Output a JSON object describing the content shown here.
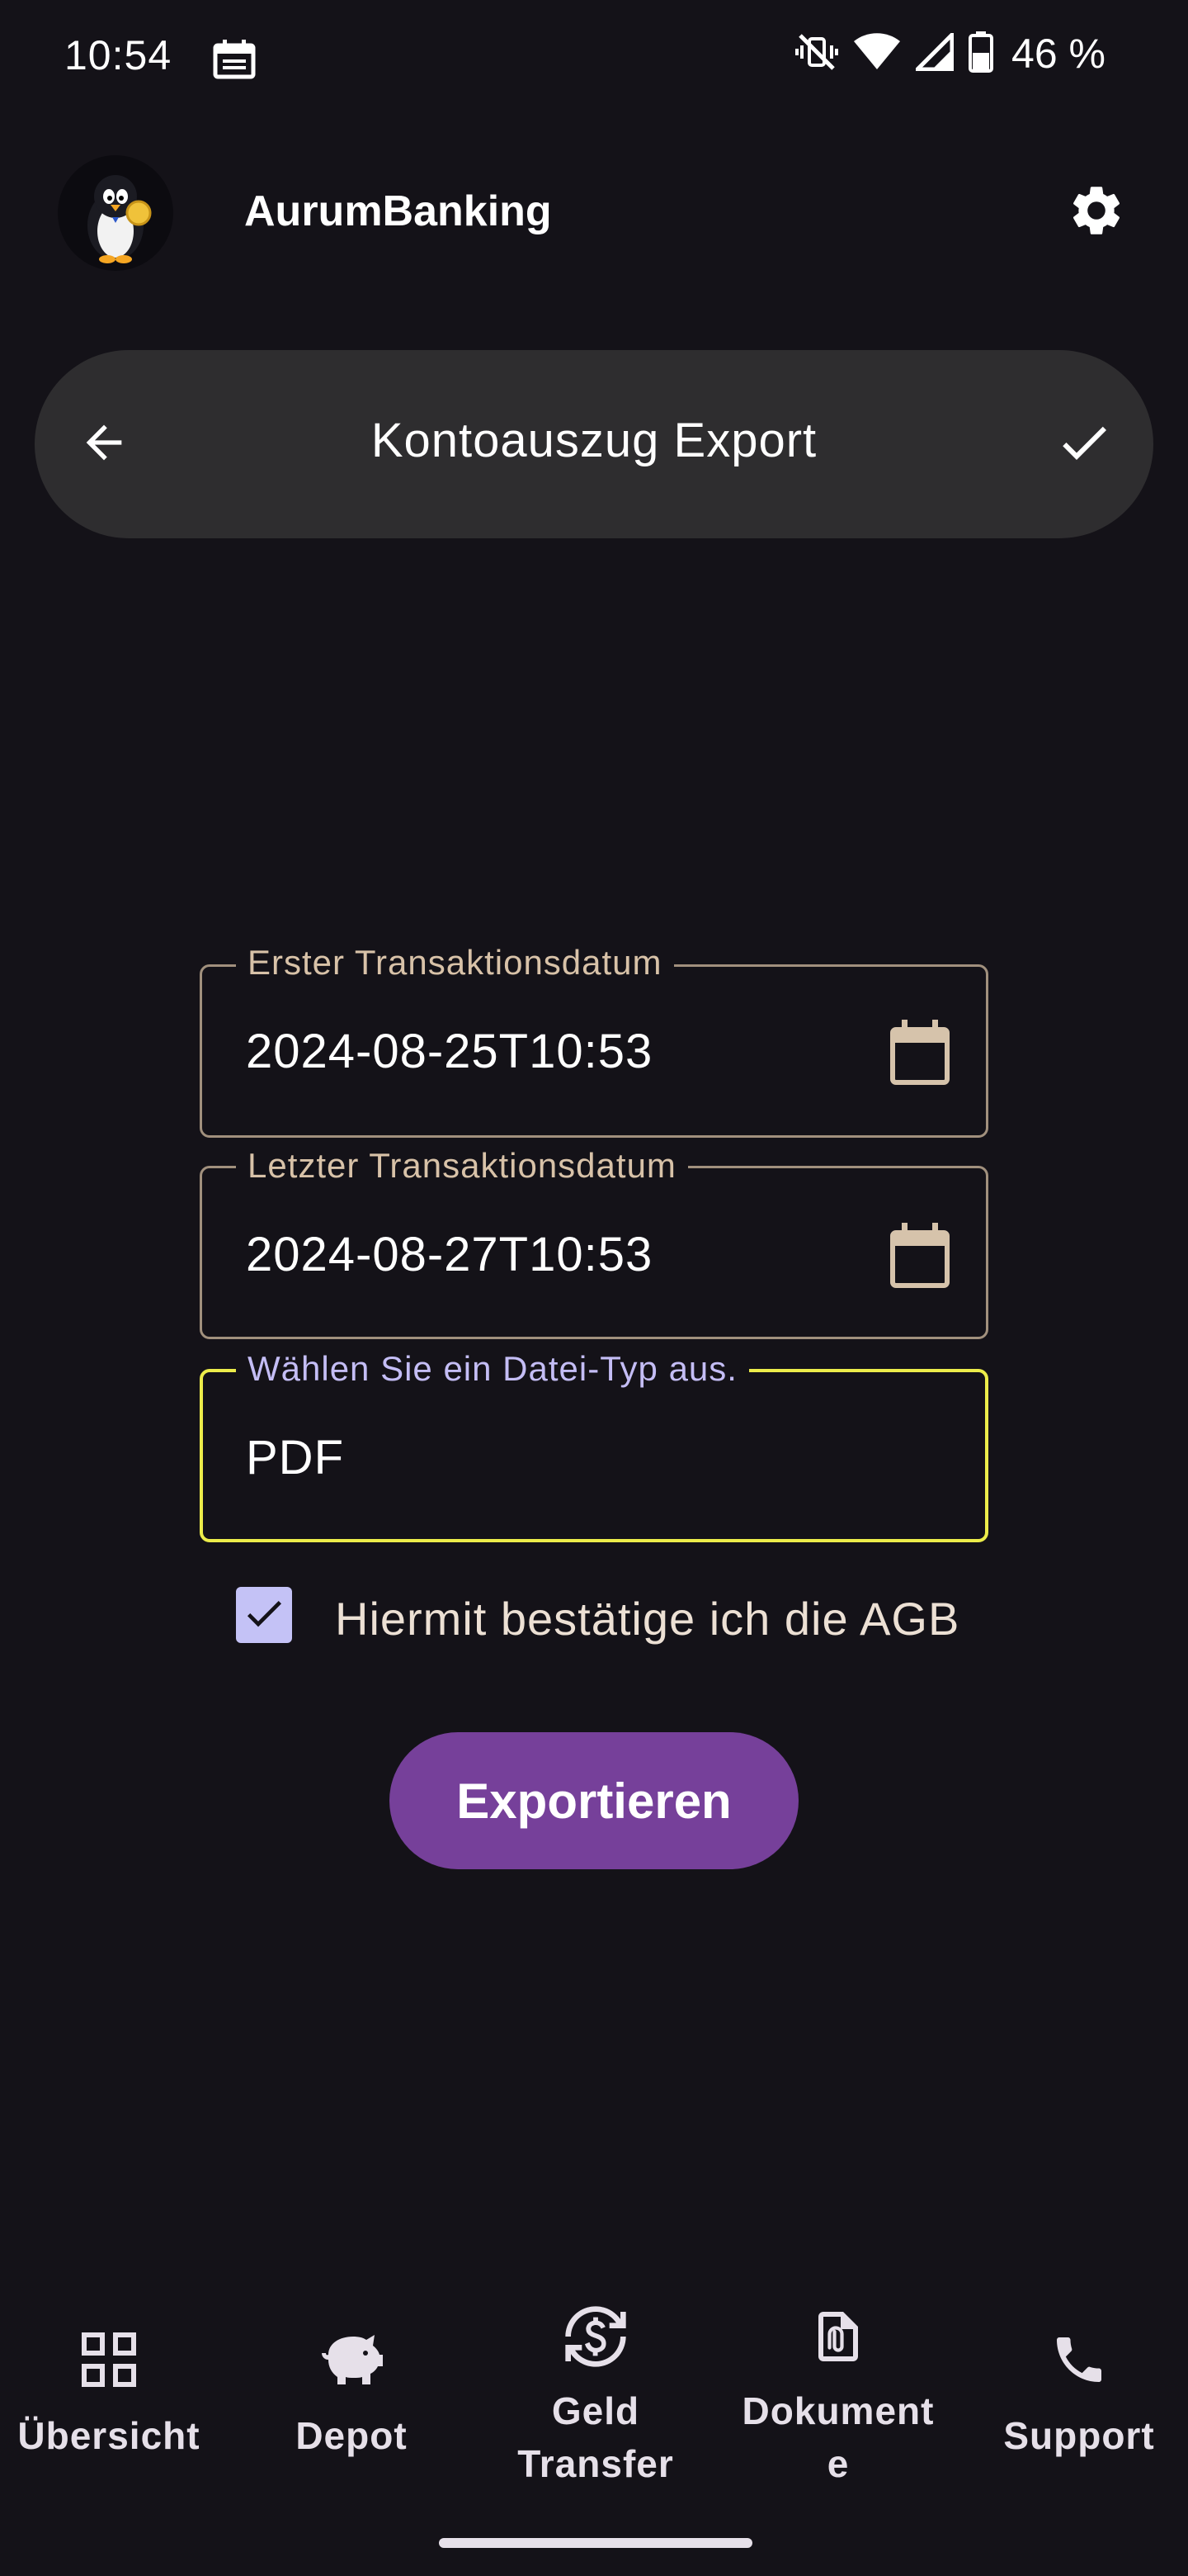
{
  "status_bar": {
    "time": "10:54",
    "battery": "46 %",
    "icons": [
      "calendar-icon",
      "mute-vibrate-icon",
      "wifi-icon",
      "signal-icon",
      "battery-icon"
    ]
  },
  "app_bar": {
    "title": "AurumBanking",
    "logo_icon": "penguin-logo",
    "settings_icon": "gear-icon"
  },
  "header": {
    "title": "Kontoauszug Export",
    "back_icon": "arrow-back-icon",
    "confirm_icon": "check-icon"
  },
  "form": {
    "first_date": {
      "label": "Erster Transaktionsdatum",
      "value": "2024-08-25T10:53",
      "icon": "calendar-icon"
    },
    "last_date": {
      "label": "Letzter Transaktionsdatum",
      "value": "2024-08-27T10:53",
      "icon": "calendar-icon"
    },
    "file_type": {
      "label": "Wählen Sie ein Datei-Typ aus.",
      "value": "PDF"
    },
    "agb": {
      "label": "Hiermit bestätige ich die AGB",
      "checked": true
    },
    "export_label": "Exportieren"
  },
  "nav": {
    "items": [
      {
        "label": "Übersicht",
        "icon": "grid-icon"
      },
      {
        "label": "Depot",
        "icon": "piggy-bank-icon"
      },
      {
        "label_line1": "Geld",
        "label_line2": "Transfer",
        "icon": "currency-exchange-icon"
      },
      {
        "label_line1": "Dokument",
        "label_line2": "e",
        "icon": "document-attachment-icon"
      },
      {
        "label": "Support",
        "icon": "phone-icon"
      }
    ]
  },
  "colors": {
    "background": "#141218",
    "pill": "#2e2d2f",
    "field_border": "#a1907d",
    "focus_border": "#ecec4a",
    "accent_button": "#76409a",
    "checkbox": "#c4c2f6"
  }
}
